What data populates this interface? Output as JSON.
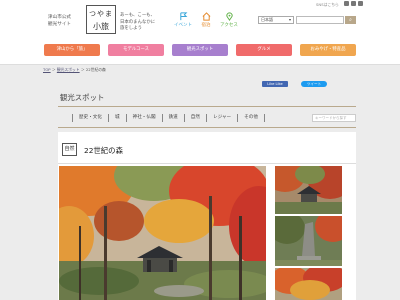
{
  "header": {
    "site_sub": [
      "津山市公式",
      "観光サイト"
    ],
    "logo": [
      "つやま",
      "小旅"
    ],
    "tagline": [
      "あーも、こーも、",
      "日本のまんなかに",
      "旅をしよう"
    ],
    "nav": [
      {
        "label": "イベント",
        "icon": "flag-icon",
        "color": "#3aa6d9"
      },
      {
        "label": "宿泊",
        "icon": "house-icon",
        "color": "#e58b2d"
      },
      {
        "label": "アクセス",
        "icon": "map-pin-icon",
        "color": "#62b24a"
      }
    ],
    "sns_label": "SNSはこちら",
    "language": "日本語",
    "search_icon": "magnifier-icon"
  },
  "categories": [
    {
      "label": "津山から「旅」",
      "color": "#ef7a4d"
    },
    {
      "label": "モデルコース",
      "color": "#f07fa0"
    },
    {
      "label": "観光スポット",
      "color": "#a77fce"
    },
    {
      "label": "グルメ",
      "color": "#f06b6b"
    },
    {
      "label": "おみやげ・特産品",
      "color": "#f0a64f"
    }
  ],
  "breadcrumb": [
    "TOP",
    "観光スポット",
    "22世紀の森"
  ],
  "page_title": "観光スポット",
  "share": {
    "fb": "Like Like",
    "tw": "ツイート"
  },
  "tabs": [
    "歴史・文化",
    "城",
    "神社・仏閣",
    "鉄道",
    "自然",
    "レジャー",
    "その他"
  ],
  "tab_search_placeholder": "キーワードから探す",
  "spot": {
    "category": "自然",
    "title": "22世紀の森"
  }
}
